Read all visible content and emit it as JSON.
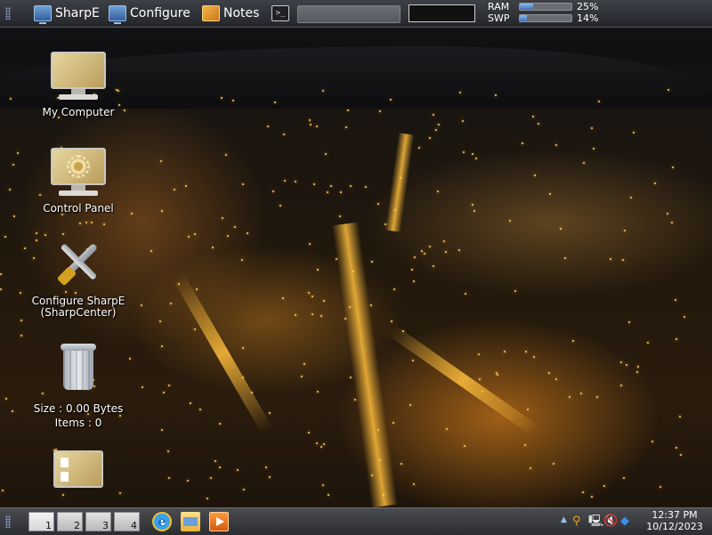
{
  "top_panel": {
    "launchers": [
      {
        "label": "SharpE",
        "icon": "monitor-icon"
      },
      {
        "label": "Configure",
        "icon": "monitor-icon"
      },
      {
        "label": "Notes",
        "icon": "notes-icon"
      }
    ],
    "terminal_icon": "terminal-icon",
    "terminal_glyph": ">_",
    "meters": [
      {
        "label": "RAM",
        "value": "25%",
        "fraction": 0.25
      },
      {
        "label": "SWP",
        "value": "14%",
        "fraction": 0.14
      }
    ]
  },
  "desktop_icons": [
    {
      "label": "My Computer",
      "icon": "computer-icon"
    },
    {
      "label": "Control Panel",
      "icon": "control-panel-icon"
    },
    {
      "label": "Configure SharpE",
      "sub": "(SharpCenter)",
      "icon": "tools-icon"
    },
    {
      "label": "Size : 0.00 Bytes",
      "sub": "Items : 0",
      "icon": "recycle-bin-icon"
    },
    {
      "label": "",
      "icon": "documents-icon"
    }
  ],
  "taskbar": {
    "workspaces": [
      "1",
      "2",
      "3",
      "4"
    ],
    "apps": [
      "internet-explorer-icon",
      "file-explorer-icon",
      "media-player-icon"
    ],
    "ie_glyph": "e",
    "tray": [
      "search-icon",
      "network-icon",
      "volume-muted-icon",
      "dropbox-icon"
    ],
    "tray_glyphs": {
      "search": "⚲",
      "network": "🖳",
      "volume": "🔇",
      "dropbox": "◆"
    },
    "arrow": "▲",
    "clock_time": "12:37 PM",
    "clock_date": "10/12/2023"
  },
  "colors": {
    "meter_fill": "#3e6fb3",
    "taskbar": "#2b2d31",
    "city_glow": "#ffb030"
  }
}
